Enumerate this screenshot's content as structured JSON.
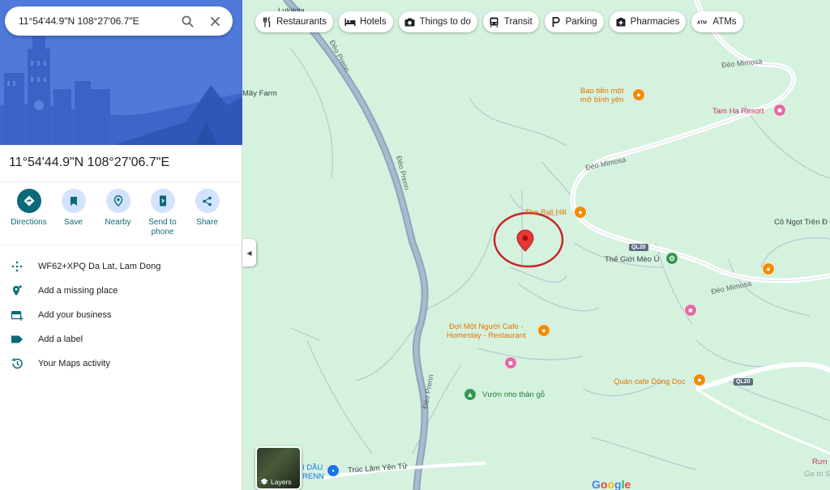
{
  "search": {
    "value": "11°54'44.9\"N 108°27'06.7\"E"
  },
  "panel": {
    "title": "11°54'44.9\"N 108°27'06.7\"E",
    "actions": [
      {
        "label": "Directions",
        "icon": "directions-icon"
      },
      {
        "label": "Save",
        "icon": "bookmark-icon"
      },
      {
        "label": "Nearby",
        "icon": "nearby-icon"
      },
      {
        "label": "Send to phone",
        "icon": "phone-icon"
      },
      {
        "label": "Share",
        "icon": "share-icon"
      }
    ],
    "info": [
      {
        "text": "WF62+XPQ Da Lat, Lam Dong",
        "icon": "plus-code-icon"
      },
      {
        "text": "Add a missing place",
        "icon": "add-place-icon"
      },
      {
        "text": "Add your business",
        "icon": "store-icon"
      },
      {
        "text": "Add a label",
        "icon": "label-icon"
      },
      {
        "text": "Your Maps activity",
        "icon": "history-icon"
      }
    ]
  },
  "chips": [
    {
      "label": "Restaurants",
      "icon": "restaurant-icon"
    },
    {
      "label": "Hotels",
      "icon": "hotel-icon"
    },
    {
      "label": "Things to do",
      "icon": "camera-icon"
    },
    {
      "label": "Transit",
      "icon": "transit-icon"
    },
    {
      "label": "Parking",
      "icon": "parking-icon"
    },
    {
      "label": "Pharmacies",
      "icon": "pharmacy-icon"
    },
    {
      "label": "ATMs",
      "icon": "atm-icon"
    }
  ],
  "map": {
    "labels": {
      "lululola": "Lululola",
      "may_farm": "Mây Farm",
      "deo_prenn_1": "Đèo Prenn",
      "deo_prenn_2": "Đèo Prenn",
      "deo_prenn_3": "Đèo Prenn",
      "deo_mimosa_1": "Đèo Mimosa",
      "deo_mimosa_2": "Đèo Mimosa",
      "deo_mimosa_3": "Đèo Mimosa",
      "bao_tien_1": "Bao tiền một",
      "bao_tien_2": "mở bình yên",
      "tam_ha": "Tam Ha Resort",
      "bali_hill": "The Bali Hill",
      "co_ngot": "Cỏ Ngọt Trên Đ",
      "ql20_1": "QL20",
      "ql20_2": "QL20",
      "the_gioi_meo": "Thế Giới Mèo Ú",
      "doi_mot_1": "Đợi Một Người Cafe -",
      "doi_mot_2": "Homestay - Restaurant",
      "quan_cafe": "Quán cafe Dông Dọc",
      "vuon_nho": "Vườn nho thân gỗ",
      "truc_lam": "Trúc Lâm Yên Tử",
      "dau_1": "I DẦU",
      "dau_2": "RENN",
      "go_to": "Go to S",
      "rum": "Rưn"
    },
    "layers_label": "Layers",
    "google": [
      "G",
      "o",
      "o",
      "g",
      "l",
      "e"
    ]
  },
  "colors": {
    "accent": "#0b6a78",
    "marker": "#e53935",
    "circle": "#c62828",
    "road": "#a7b8c9"
  }
}
